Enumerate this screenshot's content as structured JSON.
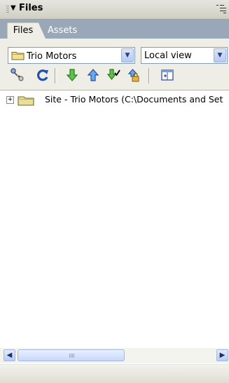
{
  "panel": {
    "title": "Files",
    "collapse_icon": "triangle-down-icon",
    "menu_icon": "panel-options-icon"
  },
  "tabs": [
    {
      "label": "Files",
      "active": true
    },
    {
      "label": "Assets",
      "active": false
    }
  ],
  "site_select": {
    "value": "Trio Motors",
    "icon": "folder-icon"
  },
  "view_select": {
    "value": "Local view"
  },
  "toolbar": [
    {
      "name": "connect-icon"
    },
    {
      "name": "refresh-icon"
    },
    {
      "name": "get-files-icon"
    },
    {
      "name": "put-files-icon"
    },
    {
      "name": "check-out-icon"
    },
    {
      "name": "check-in-icon"
    },
    {
      "name": "expand-site-icon"
    }
  ],
  "tree": {
    "rows": [
      {
        "label": "Site - Trio Motors (C:\\Documents and Set",
        "expander": "+"
      }
    ]
  },
  "colors": {
    "panel_bg": "#eeeee6",
    "tab_bar": "#9aa7b8",
    "arrow_green": "#2e9b2e",
    "arrow_blue": "#2f6fd0",
    "folder_yellow": "#e8d470"
  }
}
